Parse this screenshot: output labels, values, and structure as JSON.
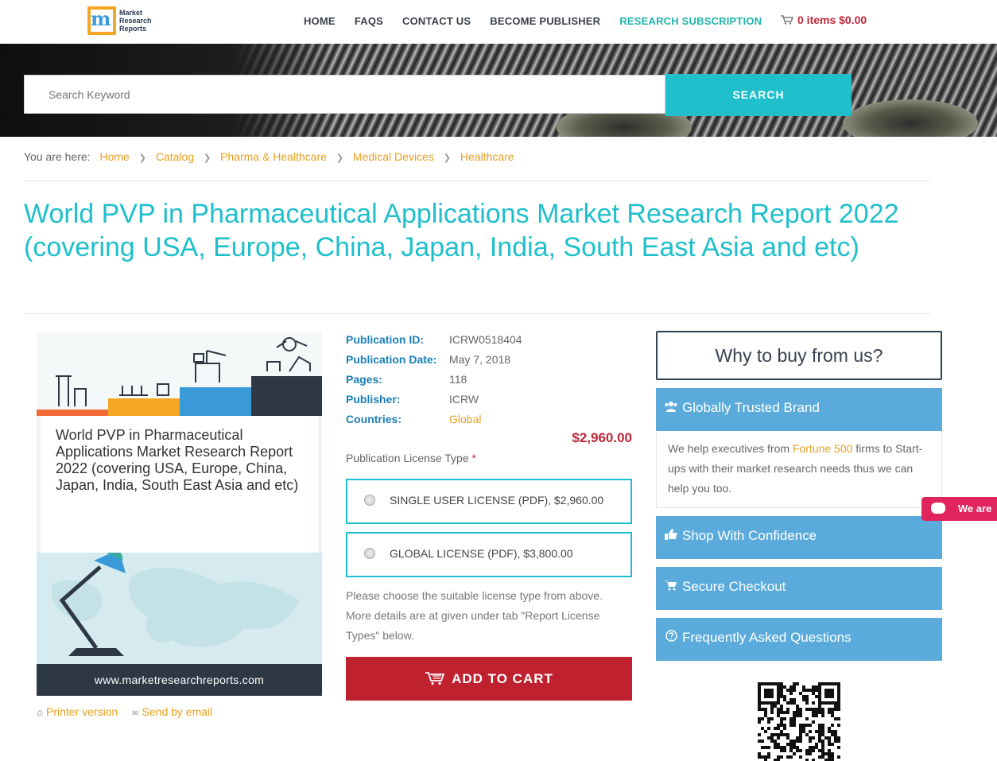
{
  "header": {
    "logo_lines": [
      "Market",
      "Research",
      "Reports"
    ],
    "logo_letter": "m",
    "nav": [
      {
        "label": "HOME"
      },
      {
        "label": "FAQS"
      },
      {
        "label": "CONTACT US"
      },
      {
        "label": "BECOME PUBLISHER"
      },
      {
        "label": "RESEARCH SUBSCRIPTION"
      }
    ],
    "cart_label": "0 items $0.00",
    "accent_color": "#1fb5ad",
    "cart_color": "#c0273a"
  },
  "search": {
    "placeholder": "Search Keyword",
    "button_label": "SEARCH"
  },
  "breadcrumb": {
    "label": "You are here:",
    "items": [
      "Home",
      "Catalog",
      "Pharma & Healthcare",
      "Medical Devices",
      "Healthcare"
    ]
  },
  "page_title": "World PVP in Pharmaceutical Applications Market Research Report 2022 (covering USA, Europe, China, Japan, India, South East Asia and etc)",
  "cover": {
    "title": "World PVP in Pharmaceutical Applications Market Research Report 2022 (covering USA, Europe, China, Japan, India, South East Asia and etc)",
    "url": "www.marketresearchreports.com"
  },
  "tools": {
    "printer": "Printer version",
    "email": "Send by email"
  },
  "details": {
    "rows": [
      {
        "label": "Publication ID:",
        "value": "ICRW0518404"
      },
      {
        "label": "Publication Date:",
        "value": "May 7, 2018"
      },
      {
        "label": "Pages:",
        "value": "118"
      },
      {
        "label": "Publisher:",
        "value": "ICRW"
      },
      {
        "label": "Countries:",
        "value": "Global"
      }
    ],
    "price": "$2,960.00",
    "license_label": "Publication License Type",
    "license_required": "*",
    "licenses": [
      {
        "label": "SINGLE USER LICENSE (PDF), $2,960.00"
      },
      {
        "label": "GLOBAL LICENSE (PDF), $3,800.00"
      }
    ],
    "note": "Please choose the suitable license type from above. More details are at given under tab \"Report License Types\" below.",
    "add_to_cart": "ADD TO CART"
  },
  "sidebar": {
    "why_title": "Why to buy from us?",
    "trusted_title": "Globally Trusted Brand",
    "trusted_body_pre": "We help executives from ",
    "trusted_body_link": "Fortune 500",
    "trusted_body_post": " firms to Start-ups with their market research needs thus we can help you too.",
    "shop": "Shop With Confidence",
    "secure": "Secure Checkout",
    "faq": "Frequently Asked Questions",
    "button_color": "#5aabdb"
  },
  "chat": {
    "label": "We are"
  }
}
